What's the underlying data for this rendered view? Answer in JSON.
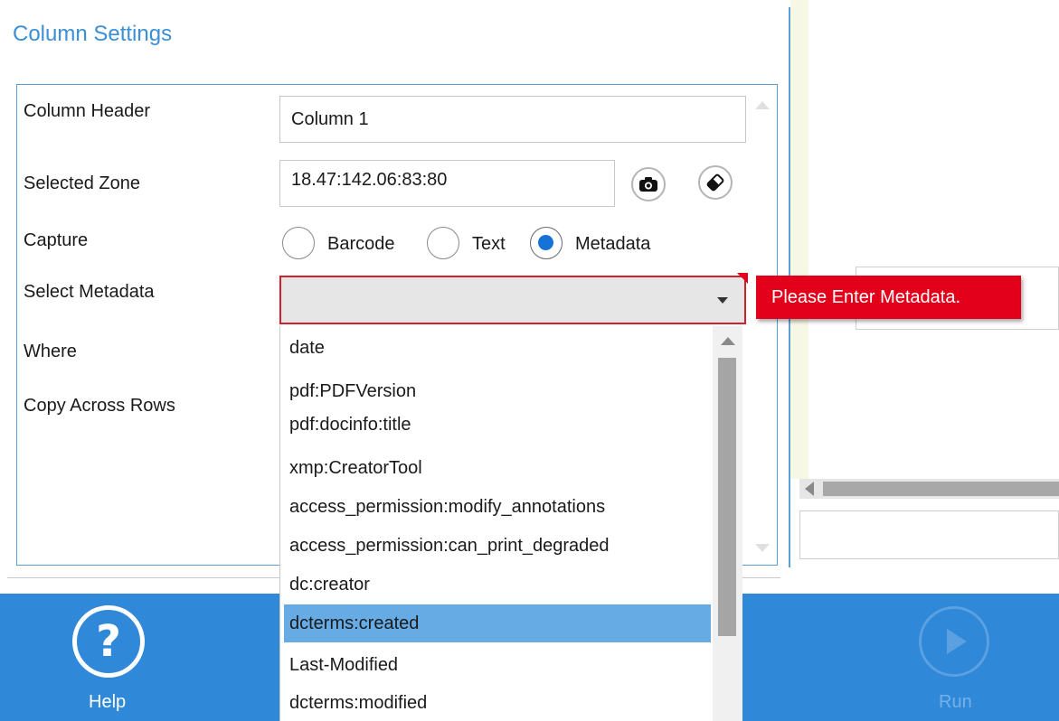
{
  "panel": {
    "title": "Column Settings"
  },
  "fields": {
    "column_header_label": "Column Header",
    "column_header_value": "Column 1",
    "selected_zone_label": "Selected Zone",
    "selected_zone_value": "18.47:142.06:83:80",
    "capture_label": "Capture",
    "select_metadata_label": "Select Metadata",
    "where_label": "Where",
    "copy_across_rows_label": "Copy Across Rows"
  },
  "capture": {
    "options": [
      "Barcode",
      "Text",
      "Metadata"
    ],
    "selected": "Metadata"
  },
  "metadata_combo": {
    "value": "",
    "error_tooltip": "Please Enter Metadata."
  },
  "dropdown": {
    "options": [
      "date",
      "pdf:PDFVersion",
      "pdf:docinfo:title",
      "xmp:CreatorTool",
      "access_permission:modify_annotations",
      "access_permission:can_print_degraded",
      "dc:creator",
      "dcterms:created",
      "Last-Modified",
      "dcterms:modified"
    ],
    "highlighted": "dcterms:created"
  },
  "footer": {
    "help_label": "Help",
    "run_label": "Run"
  },
  "icons": {
    "capture_zone": "camera-icon",
    "clear_zone": "eraser-icon",
    "help": "question-mark-icon",
    "run": "play-icon"
  },
  "colors": {
    "accent": "#2f88d8",
    "title": "#3b8fd6",
    "error": "#e2001a",
    "radio_selected": "#1672d6",
    "highlight": "#66abe4"
  }
}
